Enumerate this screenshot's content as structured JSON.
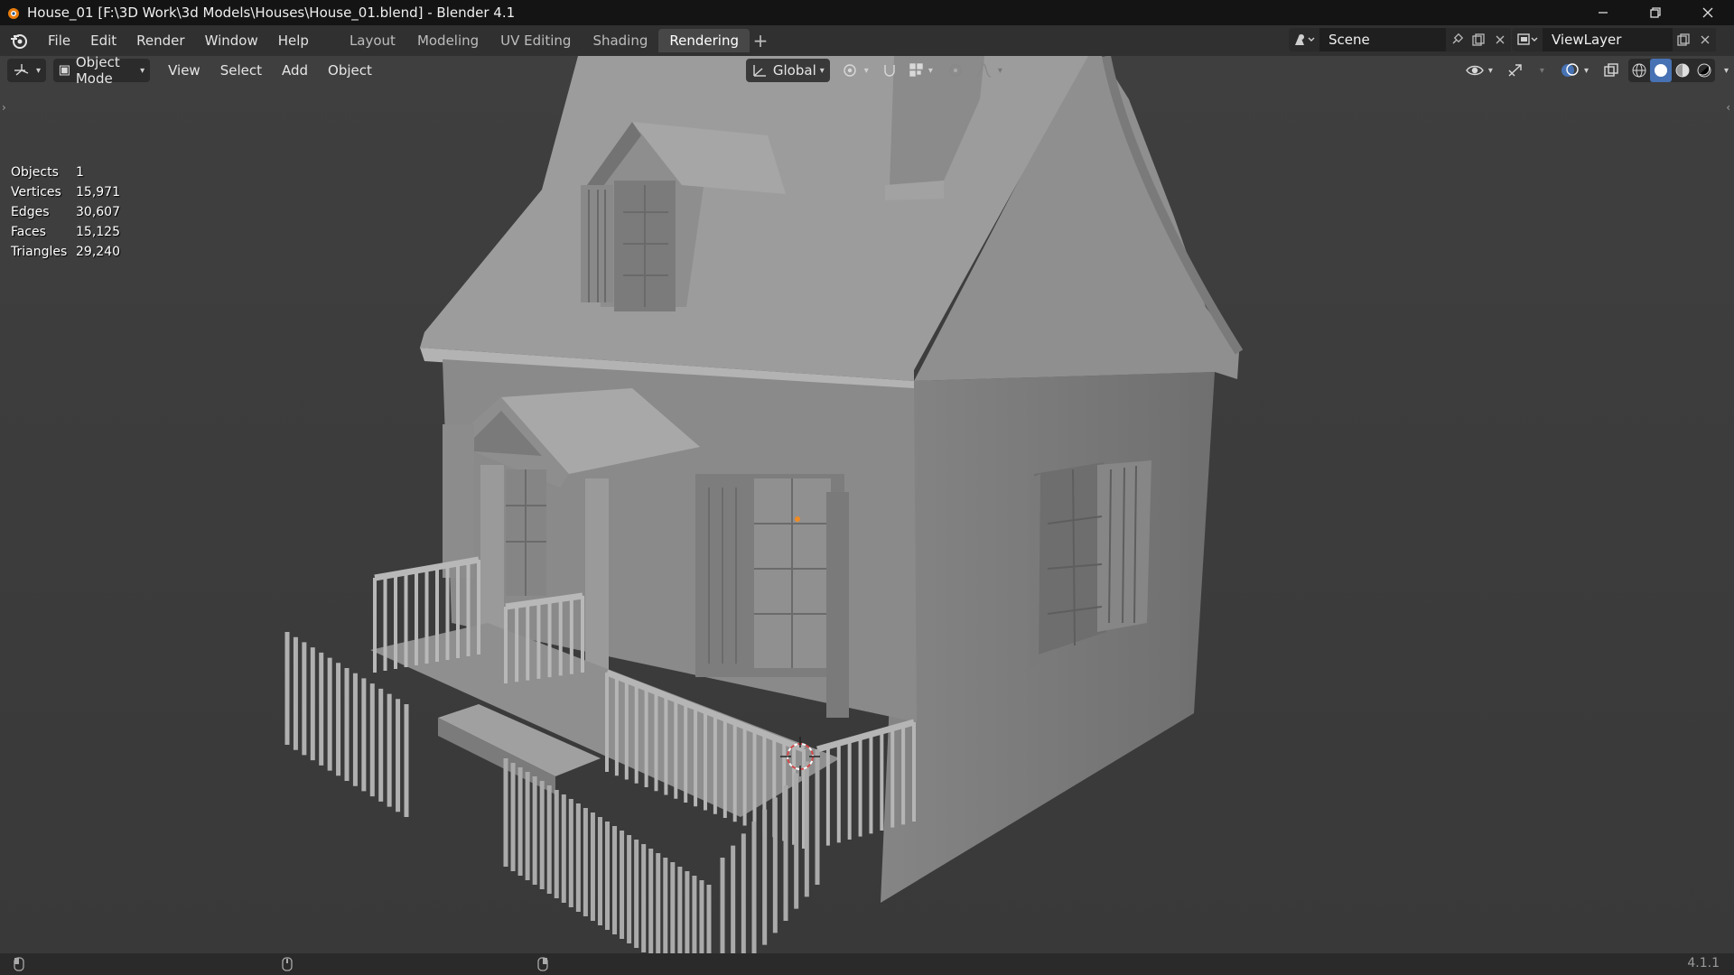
{
  "window": {
    "title": "House_01 [F:\\3D Work\\3d Models\\Houses\\House_01.blend] - Blender 4.1"
  },
  "menu": {
    "items": [
      "File",
      "Edit",
      "Render",
      "Window",
      "Help"
    ]
  },
  "workspaces": {
    "tabs": [
      "Layout",
      "Modeling",
      "UV Editing",
      "Shading",
      "Rendering"
    ],
    "active": "Rendering"
  },
  "scene": {
    "name": "Scene"
  },
  "view_layer": {
    "name": "ViewLayer"
  },
  "viewport_header": {
    "mode": "Object Mode",
    "menus": [
      "View",
      "Select",
      "Add",
      "Object"
    ],
    "orientation": "Global"
  },
  "stats": [
    {
      "label": "Objects",
      "value": "1"
    },
    {
      "label": "Vertices",
      "value": "15,971"
    },
    {
      "label": "Edges",
      "value": "30,607"
    },
    {
      "label": "Faces",
      "value": "15,125"
    },
    {
      "label": "Triangles",
      "value": "29,240"
    }
  ],
  "status_bar": {
    "version": "4.1.1"
  },
  "colors": {
    "accent": "#4772b3",
    "viewport_bg": "#3d3d3d",
    "active_tab": "#474747"
  }
}
